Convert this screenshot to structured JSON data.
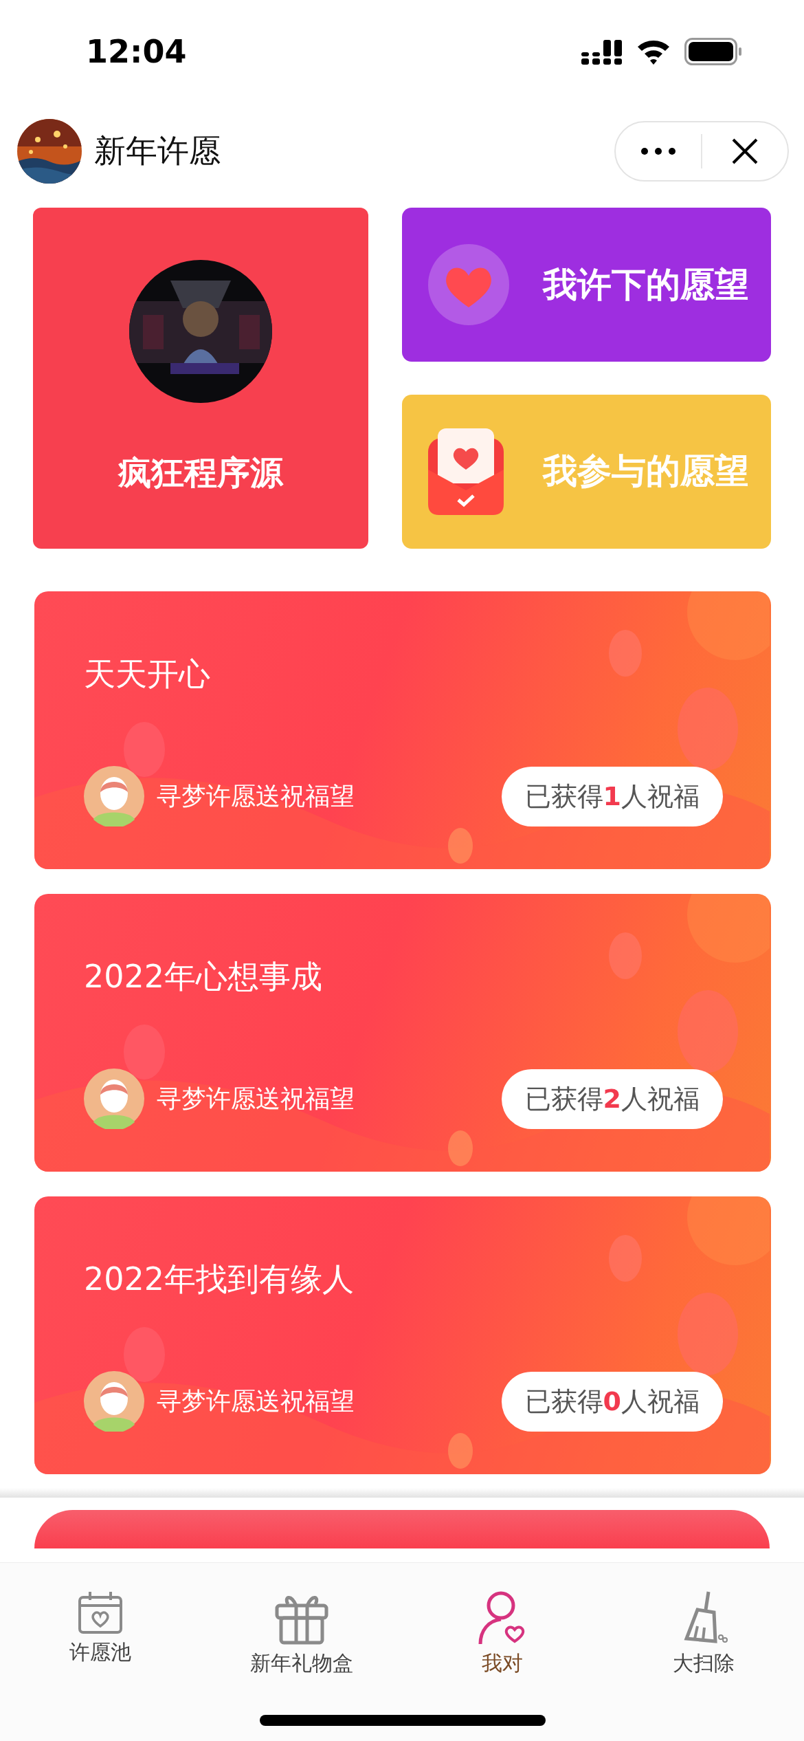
{
  "status_bar": {
    "time": "12:04"
  },
  "header": {
    "title": "新年许愿"
  },
  "profile": {
    "name": "疯狂程序源"
  },
  "shortcuts": [
    {
      "label": "我许下的愿望",
      "kind": "made"
    },
    {
      "label": "我参与的愿望",
      "kind": "joined"
    }
  ],
  "wishes": [
    {
      "title": "天天开心",
      "author": "寻梦许愿送祝福望",
      "blessings": "已获得**1**人祝福"
    },
    {
      "title": "2022年心想事成",
      "author": "寻梦许愿送祝福望",
      "blessings": "已获得**2**人祝福"
    },
    {
      "title": "2022年找到有缘人",
      "author": "寻梦许愿送祝福望",
      "blessings": "已获得**0**人祝福"
    }
  ],
  "tabs": [
    {
      "label": "许愿池",
      "kind": "calendar",
      "selected": false
    },
    {
      "label": "新年礼物盒",
      "kind": "gift",
      "selected": false
    },
    {
      "label": "我对",
      "kind": "person",
      "selected": true
    },
    {
      "label": "大扫除",
      "kind": "broom",
      "selected": false
    }
  ]
}
